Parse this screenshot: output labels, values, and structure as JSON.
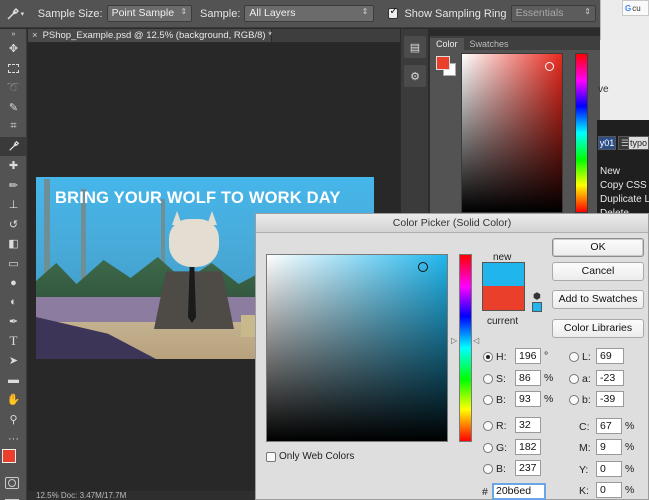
{
  "options_bar": {
    "tool_icon": "eyedropper-icon",
    "sample_size_label": "Sample Size:",
    "sample_size_value": "Point Sample",
    "sample_label": "Sample:",
    "sample_value": "All Layers",
    "sampling_ring_label": "Show Sampling Ring",
    "workspace_value": "Essentials"
  },
  "browser": {
    "tab_text": "cu"
  },
  "document": {
    "tab_title": "PShop_Example.psd @ 12.5% (background, RGB/8) *",
    "artwork_title": "BRING YOUR WOLF TO WORK DAY",
    "status_text": "12.5%   Doc: 3.47M/17.7M"
  },
  "color_panel": {
    "tabs": [
      "Color",
      "Swatches"
    ],
    "foreground_color": "#ea3f2a",
    "background_color": "#ffffff"
  },
  "side_app": {
    "lines": [
      "ve",
      "New",
      "Copy CSS",
      "Duplicate L",
      "Delete"
    ],
    "tabs": [
      "y01",
      "typo"
    ]
  },
  "picker": {
    "title": "Color Picker (Solid Color)",
    "new_label": "new",
    "current_label": "current",
    "new_color": "#20b6ed",
    "current_color": "#ea3f2a",
    "buttons": {
      "ok": "OK",
      "cancel": "Cancel",
      "add_to_swatches": "Add to Swatches",
      "color_libraries": "Color Libraries"
    },
    "fields": {
      "H": {
        "label": "H:",
        "value": "196",
        "unit": "°"
      },
      "S": {
        "label": "S:",
        "value": "86",
        "unit": "%"
      },
      "B": {
        "label": "B:",
        "value": "93",
        "unit": "%"
      },
      "R": {
        "label": "R:",
        "value": "32"
      },
      "G": {
        "label": "G:",
        "value": "182"
      },
      "Bl": {
        "label": "B:",
        "value": "237"
      },
      "L": {
        "label": "L:",
        "value": "69"
      },
      "a": {
        "label": "a:",
        "value": "-23"
      },
      "b": {
        "label": "b:",
        "value": "-39"
      },
      "C": {
        "label": "C:",
        "value": "67",
        "unit": "%"
      },
      "M": {
        "label": "M:",
        "value": "9",
        "unit": "%"
      },
      "Y": {
        "label": "Y:",
        "value": "0",
        "unit": "%"
      },
      "K": {
        "label": "K:",
        "value": "0",
        "unit": "%"
      }
    },
    "only_web_colors_label": "Only Web Colors",
    "hex_value": "20b6ed"
  }
}
